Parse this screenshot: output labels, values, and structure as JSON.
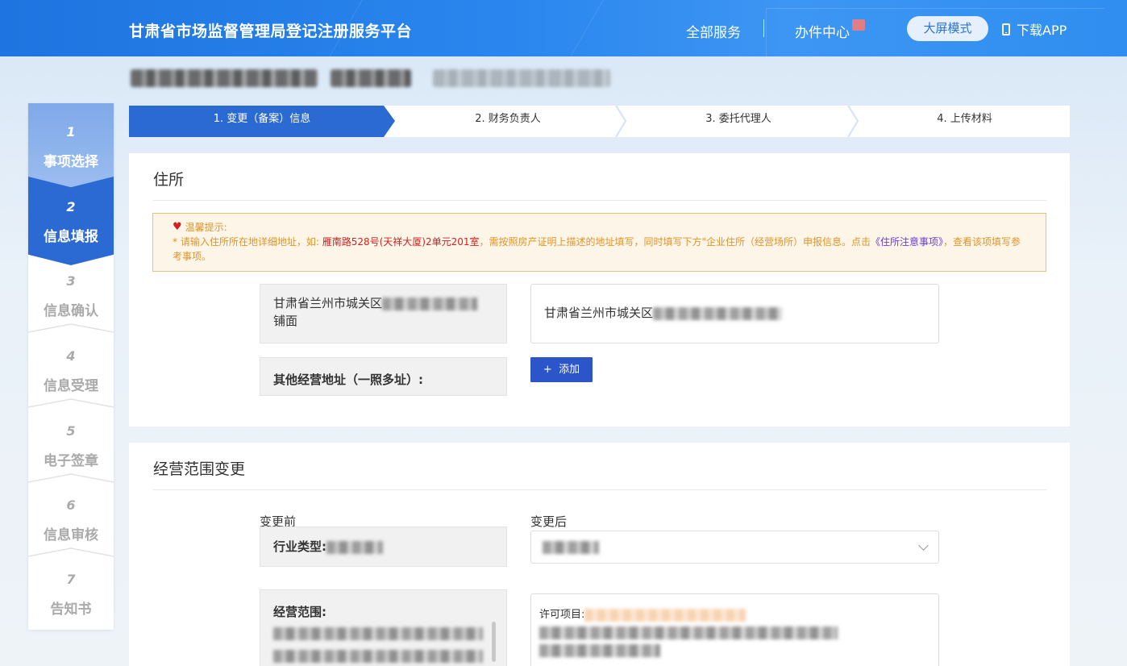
{
  "header": {
    "brand": "甘肃省市场监督管理局登记注册服务平台",
    "nav_all": "全部服务",
    "nav_center": "办件中心",
    "big_screen": "大屏模式",
    "download": "下载APP"
  },
  "sidebar": {
    "steps": [
      {
        "num": "1",
        "label": "事项选择"
      },
      {
        "num": "2",
        "label": "信息填报"
      },
      {
        "num": "3",
        "label": "信息确认"
      },
      {
        "num": "4",
        "label": "信息受理"
      },
      {
        "num": "5",
        "label": "电子签章"
      },
      {
        "num": "6",
        "label": "信息审核"
      },
      {
        "num": "7",
        "label": "告知书"
      }
    ]
  },
  "stepper": {
    "items": [
      "1. 变更（备案）信息",
      "2. 财务负责人",
      "3. 委托代理人",
      "4. 上传材料"
    ]
  },
  "address_section": {
    "title": "住所",
    "tip_head": "温馨提示:",
    "tip_text_1": "* 请输入住所所在地详细地址，如: ",
    "tip_example": "雁南路528号(天祥大厦)2单元201室",
    "tip_text_2": "，需按照房产证明上描述的地址填写，同时填写下方\"企业住所（经营场所）申报信息。点击",
    "tip_link": "《住所注意事项》",
    "tip_text_3": "，查看该项填写参考事项。",
    "old_address_prefix": "甘肃省兰州市城关区",
    "old_address_suffix": "铺面",
    "new_address_prefix": "甘肃省兰州市城关区",
    "other_address_label": "其他经营地址（一照多址）:",
    "add_button": "添加",
    "add_icon": "+"
  },
  "scope_section": {
    "title": "经营范围变更",
    "before_label": "变更前",
    "after_label": "变更后",
    "industry_label": "行业类型:",
    "scope_label": "经营范围:",
    "permit_label": "许可项目:"
  }
}
